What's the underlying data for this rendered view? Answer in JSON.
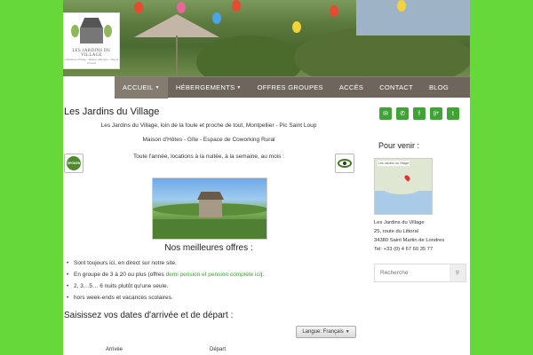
{
  "site": {
    "logo_name": "LES JARDINS DU VILLAGE",
    "logo_tagline": "Chambres d'hôtes · Maison d'Écoute · Gîte et Cowork"
  },
  "nav": {
    "items": [
      {
        "label": "ACCUEIL",
        "has_dropdown": true,
        "active": true
      },
      {
        "label": "HÉBERGEMENTS",
        "has_dropdown": true,
        "active": false
      },
      {
        "label": "OFFRES GROUPES",
        "has_dropdown": false,
        "active": false
      },
      {
        "label": "ACCÈS",
        "has_dropdown": false,
        "active": false
      },
      {
        "label": "CONTACT",
        "has_dropdown": false,
        "active": false
      },
      {
        "label": "BLOG",
        "has_dropdown": false,
        "active": false
      }
    ]
  },
  "main": {
    "title": "Les Jardins du Village",
    "subtitle": "Les Jardins du Village, loin de la foule et proche de tout, Montpellier - Pic Saint Loup",
    "description": "Maison d'Hôtes - Gîte - Espace de Coworking Rural",
    "intro": "Toute l'année, locations à la nuitée, à la semaine, au mois :",
    "badge_left": "SPOKEN",
    "offers_title": "Nos meilleures offres :",
    "offers": {
      "item1": "Sont toujours ici, en direct sur notre site.",
      "item2_prefix": "En groupe de 3 à 20 ou plus (offres ",
      "item2_link": "demi pension et pension complète ici",
      "item2_suffix": ").",
      "item3": "2, 3…5… 6 nuits plutôt qu'une seule.",
      "item4": "hors week-ends et vacances scolaires."
    },
    "dates_title": "Saisissez vos dates d'arrivée et de départ :",
    "language_selector": "Langue: Français",
    "arrival_label": "Arrivée",
    "departure_label": "Départ"
  },
  "sidebar": {
    "social": [
      {
        "icon": "email-icon",
        "glyph": "✉"
      },
      {
        "icon": "phone-icon",
        "glyph": "✆"
      },
      {
        "icon": "facebook-icon",
        "glyph": "f"
      },
      {
        "icon": "google-plus-icon",
        "glyph": "g+"
      },
      {
        "icon": "twitter-icon",
        "glyph": "t"
      }
    ],
    "directions_title": "Pour venir :",
    "map_label": "Les Jardins du Village",
    "address": {
      "name": "Les Jardins du Village",
      "street": "25, route du Littoral",
      "city": "34380 Saint Martin de Londres",
      "phone": "Tel: +33 (0) 4 67 60 35 77"
    },
    "search_placeholder": "Recherche"
  },
  "colors": {
    "background": "#66d83a",
    "nav": "#6e665c",
    "accent": "#3fa336"
  }
}
